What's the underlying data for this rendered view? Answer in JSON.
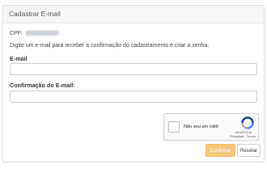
{
  "panel": {
    "title": "Cadastrar E-mail"
  },
  "cpf": {
    "label": "CPF:"
  },
  "instruction": "Digite um e-mail para receber a confirmação do cadastramento e criar a senha.",
  "fields": {
    "email_label": "E-mail",
    "email_value": "",
    "confirm_label": "Confirmação do E-mail:",
    "confirm_value": ""
  },
  "recaptcha": {
    "label": "Não sou um robô",
    "brand": "reCAPTCHA",
    "links": "Privacidade - Termos"
  },
  "buttons": {
    "confirm": "Confirmar",
    "reset": "Resetar"
  },
  "colors": {
    "confirm_button": "#f7c97a",
    "panel_heading": "#f5f5f5"
  }
}
